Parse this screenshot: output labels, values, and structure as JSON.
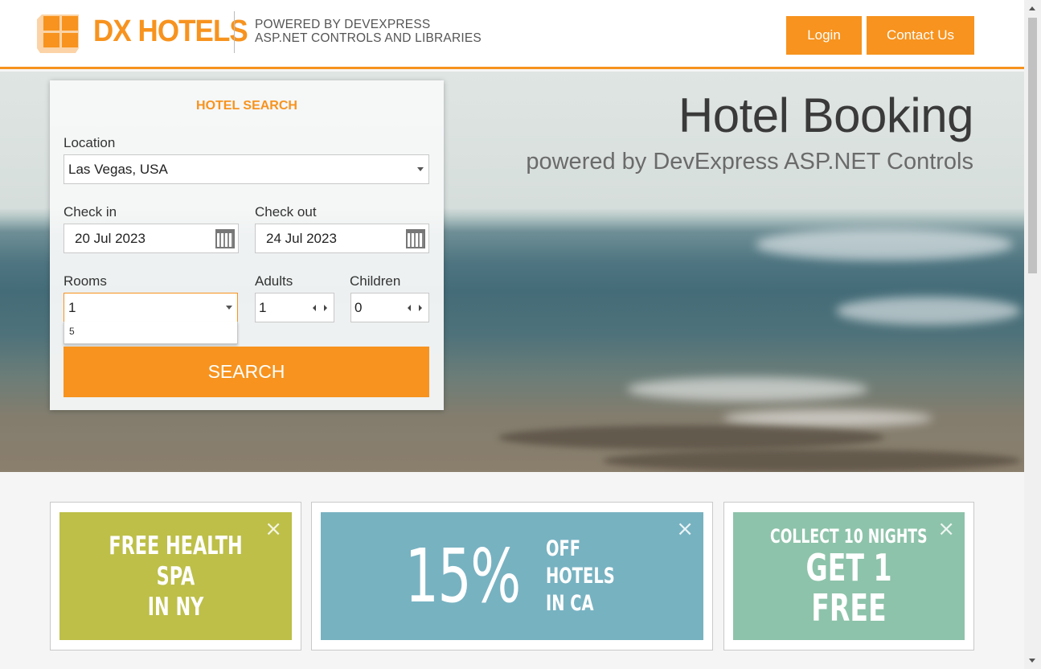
{
  "header": {
    "brand": "DX HOTELS",
    "tagline_line1": "POWERED BY DEVEXPRESS",
    "tagline_line2": "ASP.NET CONTROLS AND LIBRARIES",
    "login_label": "Login",
    "contact_label": "Contact Us"
  },
  "hero": {
    "title": "Hotel Booking",
    "subtitle": "powered by DevExpress ASP.NET Controls"
  },
  "search": {
    "title": "HOTEL SEARCH",
    "location_label": "Location",
    "location_value": "Las Vegas, USA",
    "checkin_label": "Check in",
    "checkin_value": "20 Jul 2023",
    "checkout_label": "Check out",
    "checkout_value": "24 Jul 2023",
    "rooms_label": "Rooms",
    "rooms_value": "1",
    "rooms_dropdown_item": "5",
    "adults_label": "Adults",
    "adults_value": "1",
    "children_label": "Children",
    "children_value": "0",
    "button_label": "SEARCH"
  },
  "promos": [
    {
      "line1": "FREE HEALTH SPA",
      "line2": "IN NY",
      "color": "#bdbf48"
    },
    {
      "big": "15%",
      "line1": "OFF",
      "line2": "HOTELS",
      "line3": "IN CA",
      "color": "#77b2c1"
    },
    {
      "line1": "COLLECT 10 NIGHTS",
      "line2": "GET 1 FREE",
      "color": "#8dc3aa"
    }
  ],
  "icons": {
    "close": "×"
  },
  "colors": {
    "accent": "#f7931e"
  }
}
